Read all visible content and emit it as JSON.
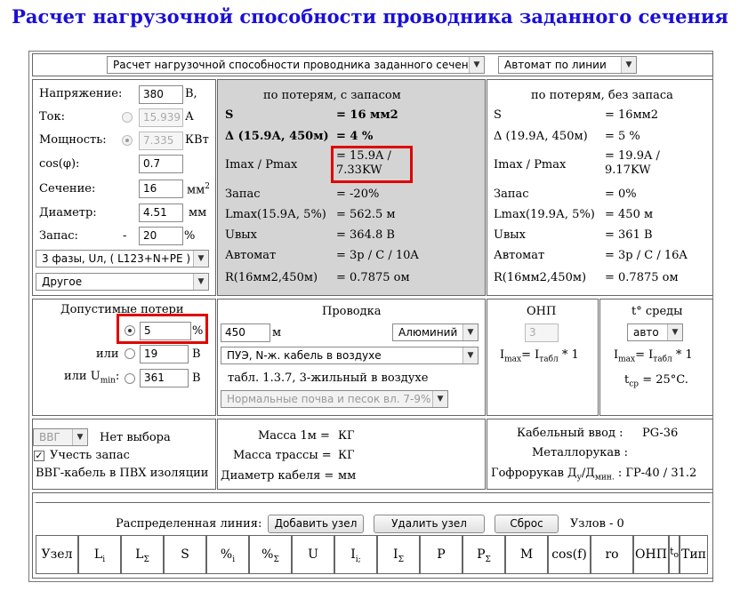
{
  "title": "Расчет нагрузочной способности проводника заданного сечения",
  "top": {
    "mode_select": "Расчет нагрузочной способности проводника заданного сечения",
    "breaker_select": "Автомат по линии"
  },
  "params": {
    "voltage_label": "Напряжение:",
    "voltage_value": "380",
    "voltage_unit": "В,",
    "current_label": "Ток:",
    "current_value": "15.939",
    "current_unit": "А",
    "power_label": "Мощность:",
    "power_value": "7.335",
    "power_unit": "КВт",
    "cos_label": "cos(φ):",
    "cos_value": "0.7",
    "section_label": "Сечение:",
    "section_value": "16",
    "section_unit": "мм",
    "section_sup": "2",
    "diameter_label": "Диаметр:",
    "diameter_value": "4.51",
    "diameter_unit": "мм",
    "reserve_label": "Запас:",
    "reserve_dash": "-",
    "reserve_value": "20",
    "reserve_unit": "%",
    "phase_select": "3 фазы, Uл,  ( L123+N+PE )",
    "other_select": "Другое"
  },
  "with_reserve": {
    "header": "по потерям, с запасом",
    "rows": [
      {
        "label": "S",
        "value": "= 16 мм2"
      },
      {
        "label": "Δ (15.9А, 450м)",
        "value": "= 4 %"
      },
      {
        "label": "Imax / Pmax",
        "value": "= 15.9A / 7.33KW"
      },
      {
        "label": "Запас",
        "value": "= -20%"
      },
      {
        "label": "Lmax(15.9А, 5%)",
        "value": "= 562.5 м"
      },
      {
        "label": "Uвых",
        "value": "= 364.8 В"
      },
      {
        "label": "Автомат",
        "value": "= 3p / C / 10A"
      },
      {
        "label": "R(16мм2,450м)",
        "value": "= 0.7875 ом"
      }
    ]
  },
  "without_reserve": {
    "header": "по потерям, без запаса",
    "rows": [
      {
        "label": "S",
        "value": "= 16мм2"
      },
      {
        "label": "Δ (19.9А, 450м)",
        "value": "= 5 %"
      },
      {
        "label": "Imax / Pmax",
        "value": "= 19.9A / 9.17KW"
      },
      {
        "label": "Запас",
        "value": "= 0%"
      },
      {
        "label": "Lmax(19.9А, 5%)",
        "value": "= 450 м"
      },
      {
        "label": "Uвых",
        "value": "= 361 В"
      },
      {
        "label": "Автомат",
        "value": "= 3p / C / 16A"
      },
      {
        "label": "R(16мм2,450м)",
        "value": "= 0.7875 ом"
      }
    ]
  },
  "losses": {
    "header": "Допустимые потери",
    "percent_value": "5",
    "percent_unit": "%",
    "or1": "или",
    "volt_value": "19",
    "volt_unit": "В",
    "or2": "или U",
    "umin_sub": "min",
    "colon": ":",
    "umin_value": "361",
    "umin_unit": "В"
  },
  "wiring": {
    "header": "Проводка",
    "length_value": "450",
    "length_unit": "м",
    "material_select": "Алюминий",
    "install_select": "ПУЭ, N-ж. кабель в воздухе",
    "table_note": "табл. 1.3.7, 3-жильный в воздухе",
    "soil_select": "Нормальные почва и песок вл. 7-9%"
  },
  "onp": {
    "header": "ОНП",
    "value": "3",
    "formula_a": "I",
    "formula_a_sub": "max",
    "formula_b": "= I",
    "formula_b_sub": "табл",
    "formula_c": "* 1"
  },
  "temp": {
    "header": "t° среды",
    "select": "авто",
    "formula_a": "I",
    "formula_a_sub": "max",
    "formula_b": "= I",
    "formula_b_sub": "табл",
    "formula_c": "* 1",
    "tcp_a": "t",
    "tcp_sub": "ср",
    "tcp_b": "= 25°C."
  },
  "cable": {
    "select": "ВВГ",
    "no_choice": "Нет выбора",
    "check_label": "Учесть запас",
    "desc": "ВВГ-кабель в ПВХ изоляции"
  },
  "mass": {
    "m1_label": "Масса 1м =",
    "m1_unit": "КГ",
    "route_label": "Масса трассы =",
    "route_unit": "КГ",
    "dia_label": "Диаметр кабеля =",
    "dia_unit": "мм"
  },
  "entry": {
    "cable_entry_label": "Кабельный ввод :",
    "cable_entry_value": "PG-36",
    "metal_label": "Металлорукав :",
    "corr_label": "Гофрорукав Д",
    "corr_sub1": "у",
    "corr_slash": "/Д",
    "corr_sub2": "мин.",
    "corr_value": ": ГР-40 / 31.2"
  },
  "distributed": {
    "label": "Распределенная линия:",
    "add_button": "Добавить узел",
    "delete_button": "Удалить узел",
    "reset_button": "Сброс",
    "nodes_label": "Узлов - 0"
  },
  "table_headers": [
    {
      "main": "Узел",
      "sub": ""
    },
    {
      "main": "L",
      "sub": "i"
    },
    {
      "main": "L",
      "sub": "Σ"
    },
    {
      "main": "S",
      "sub": ""
    },
    {
      "main": "%",
      "sub": "i"
    },
    {
      "main": "%",
      "sub": "Σ"
    },
    {
      "main": "U",
      "sub": ""
    },
    {
      "main": "I",
      "sub": "i;"
    },
    {
      "main": "I",
      "sub": "Σ"
    },
    {
      "main": "P",
      "sub": ""
    },
    {
      "main": "P",
      "sub": "Σ"
    },
    {
      "main": "M",
      "sub": ""
    },
    {
      "main": "cos(f)",
      "sub": ""
    },
    {
      "main": "ro",
      "sub": ""
    },
    {
      "main": "ОНП",
      "sub": ""
    },
    {
      "main": "t",
      "sub": "o"
    },
    {
      "main": "Тип",
      "sub": ""
    }
  ],
  "colors": {
    "title": "#1a0fd6",
    "highlight": "#e00000",
    "grey_panel": "#d4d4d4"
  }
}
